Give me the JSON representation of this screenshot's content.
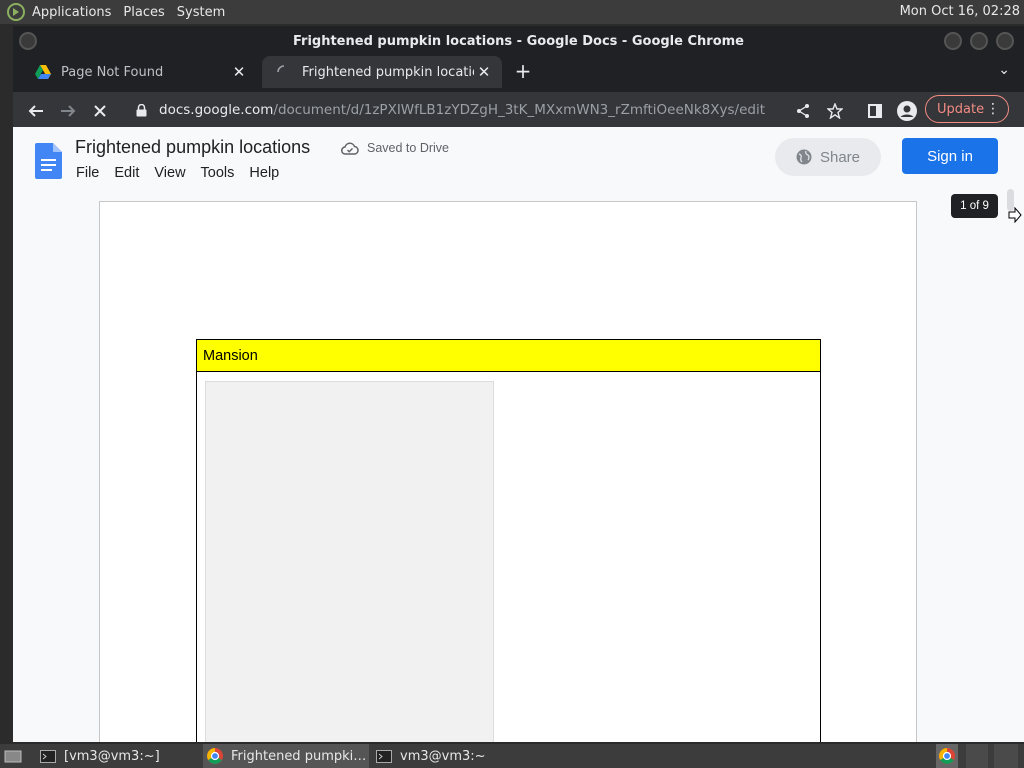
{
  "system": {
    "menus": [
      "Applications",
      "Places",
      "System"
    ],
    "clock": "Mon Oct 16, 02:28"
  },
  "window": {
    "title": "Frightened pumpkin locations - Google Docs - Google Chrome"
  },
  "tabs": [
    {
      "label": "Page Not Found",
      "favicon": "google-drive-icon",
      "active": false
    },
    {
      "label": "Frightened pumpkin locations",
      "favicon": "loading-spinner-icon",
      "active": true
    }
  ],
  "toolbar": {
    "url_host": "docs.google.com",
    "url_path": "/document/d/1zPXIWfLB1zYDZgH_3tK_MXxmWN3_rZmftiOeeNk8Xys/edit",
    "update_label": "Update"
  },
  "docs": {
    "title": "Frightened pumpkin locations",
    "saved_status": "Saved to Drive",
    "menu": [
      "File",
      "Edit",
      "View",
      "Tools",
      "Help"
    ],
    "share_label": "Share",
    "signin_label": "Sign in",
    "page_counter": "1 of 9"
  },
  "document": {
    "table_header": "Mansion"
  },
  "taskbar": {
    "items": [
      {
        "label": "[vm3@vm3:~]",
        "icon": "terminal-icon"
      },
      {
        "label": "Frightened pumpki…",
        "icon": "chrome-icon"
      },
      {
        "label": "vm3@vm3:~",
        "icon": "terminal-icon"
      }
    ]
  },
  "colors": {
    "table_header_bg": "#ffff00",
    "signin_bg": "#1a73e8",
    "update_accent": "#f28b82"
  }
}
